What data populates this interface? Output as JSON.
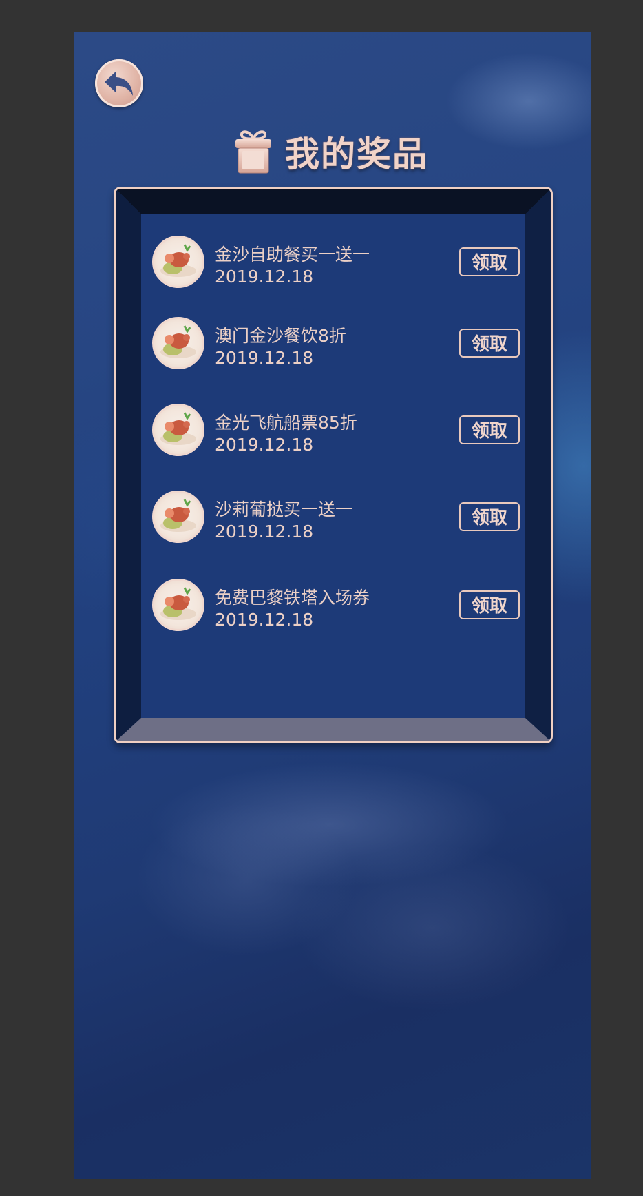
{
  "header": {
    "title": "我的奖品",
    "back_icon": "back-arrow-icon",
    "gift_icon": "gift-icon"
  },
  "colors": {
    "accent": "#f1d3c8",
    "background": "#21407e",
    "frame_border": "#f0d0c3"
  },
  "prizes": [
    {
      "name": "金沙自助餐买一送一",
      "date": "2019.12.18",
      "action": "领取"
    },
    {
      "name": "澳门金沙餐饮8折",
      "date": "2019.12.18",
      "action": "领取"
    },
    {
      "name": "金光飞航船票85折",
      "date": "2019.12.18",
      "action": "领取"
    },
    {
      "name": "沙莉葡挞买一送一",
      "date": "2019.12.18",
      "action": "领取"
    },
    {
      "name": "免费巴黎铁塔入场券",
      "date": "2019.12.18",
      "action": "领取"
    }
  ]
}
